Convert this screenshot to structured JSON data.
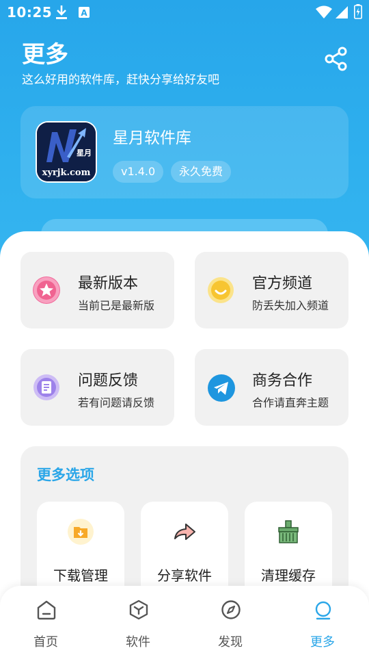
{
  "status_bar": {
    "time": "10:25",
    "icons": [
      "download-icon",
      "a-text-icon",
      "wifi-icon",
      "signal-icon",
      "battery-icon"
    ]
  },
  "header": {
    "title": "更多",
    "subtitle": "这么好用的软件库，赶快分享给好友吧",
    "share_icon": "share-icon"
  },
  "app_card": {
    "logo_text": "xyrjk.com",
    "logo_mark": "星月",
    "name": "星月软件库",
    "version": "v1.4.0",
    "tag": "永久免费"
  },
  "tiles": [
    {
      "title": "最新版本",
      "subtitle": "当前已是最新版",
      "icon": "star-icon"
    },
    {
      "title": "官方频道",
      "subtitle": "防丢失加入频道",
      "icon": "smile-icon"
    },
    {
      "title": "问题反馈",
      "subtitle": "若有问题请反馈",
      "icon": "feedback-icon"
    },
    {
      "title": "商务合作",
      "subtitle": "合作请直奔主题",
      "icon": "telegram-icon"
    }
  ],
  "more_options": {
    "title": "更多选项",
    "items": [
      {
        "label": "下载管理",
        "icon": "download-folder-icon"
      },
      {
        "label": "分享软件",
        "icon": "share-arrow-icon"
      },
      {
        "label": "清理缓存",
        "icon": "broom-icon"
      }
    ]
  },
  "bottom_nav": {
    "items": [
      {
        "label": "首页",
        "icon": "home-icon"
      },
      {
        "label": "软件",
        "icon": "box-icon"
      },
      {
        "label": "发现",
        "icon": "compass-icon"
      },
      {
        "label": "更多",
        "icon": "user-icon"
      }
    ],
    "active_index": 3
  },
  "colors": {
    "header_blue": "#27a6ea",
    "accent": "#2aa6e8",
    "tile_bg": "#f1f1f1"
  }
}
